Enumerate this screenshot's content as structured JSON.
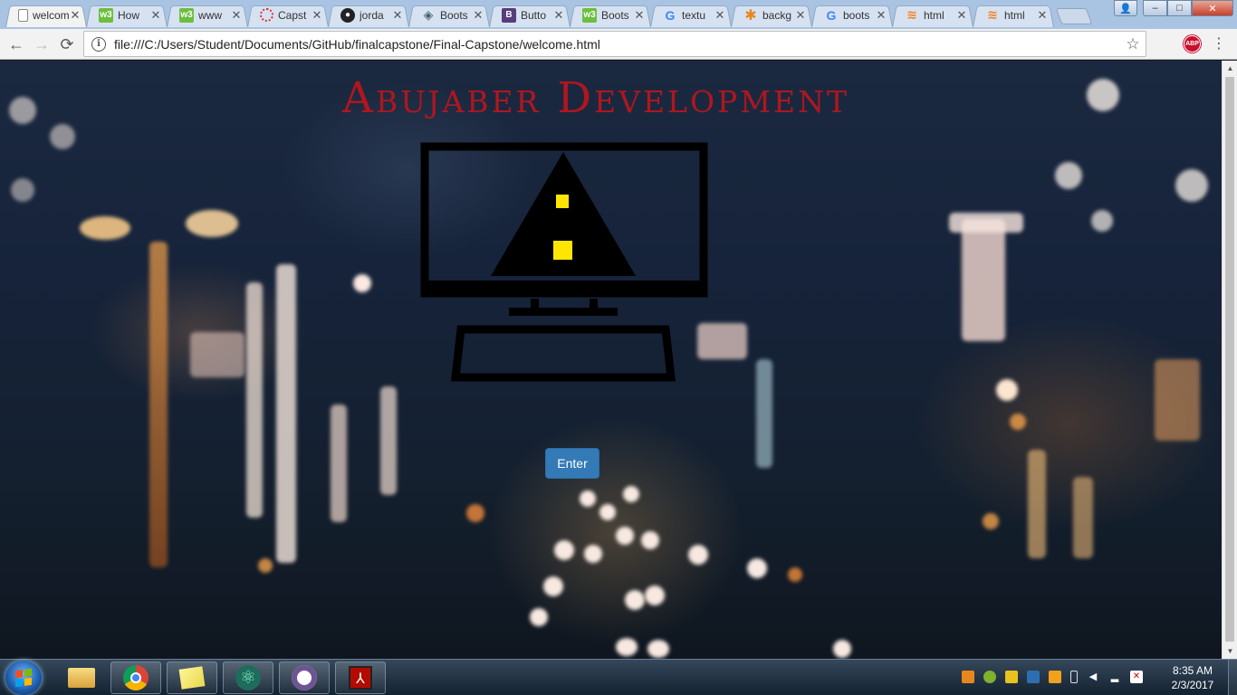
{
  "browser": {
    "tabs": [
      {
        "label": "welcome",
        "icon": "page-icon",
        "active": true
      },
      {
        "label": "How",
        "icon": "w3schools-icon"
      },
      {
        "label": "www",
        "icon": "w3schools-icon"
      },
      {
        "label": "Capst",
        "icon": "loading-icon"
      },
      {
        "label": "jorda",
        "icon": "github-icon"
      },
      {
        "label": "Boots",
        "icon": "bootsnipp-icon"
      },
      {
        "label": "Butto",
        "icon": "bootstrap-icon"
      },
      {
        "label": "Boots",
        "icon": "w3schools-icon"
      },
      {
        "label": "textu",
        "icon": "google-icon"
      },
      {
        "label": "backg",
        "icon": "asterisk-icon"
      },
      {
        "label": "boots",
        "icon": "google-icon"
      },
      {
        "label": "html",
        "icon": "stackoverflow-icon"
      },
      {
        "label": "html",
        "icon": "stackoverflow-icon"
      }
    ],
    "address_url": "file:///C:/Users/Student/Documents/GitHub/finalcapstone/Final-Capstone/welcome.html",
    "extension_badge": "ABP",
    "nav": {
      "back": "←",
      "forward": "→",
      "reload": "⟳",
      "info": "i",
      "star": "☆",
      "menu": "⋮"
    },
    "window": {
      "minimize": "–",
      "maximize": "□",
      "close": "✕",
      "user": "👤"
    }
  },
  "page": {
    "site_title": "Abujaber Development",
    "enter_button": "Enter",
    "colors": {
      "title": "#b0161f",
      "button": "#337ab7",
      "logo_stroke": "#000000",
      "logo_accent": "#ffe600"
    }
  },
  "taskbar": {
    "pinned": [
      "explorer-icon",
      "chrome-icon",
      "sticky-notes-icon",
      "atom-icon",
      "github-desktop-icon",
      "acrobat-icon"
    ],
    "clock_time": "8:35 AM",
    "clock_date": "2/3/2017"
  }
}
